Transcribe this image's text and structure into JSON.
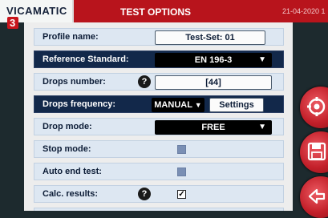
{
  "header": {
    "logo_prefix": "VICAMATIC",
    "logo_badge": "3",
    "title": "TEST OPTIONS",
    "date": "21-04-2020 1"
  },
  "form": {
    "profile_name": {
      "label": "Profile name:",
      "value": "Test-Set: 01"
    },
    "reference_standard": {
      "label": "Reference Standard:",
      "value": "EN 196-3"
    },
    "drops_number": {
      "label": "Drops number:",
      "value": "[44]",
      "help": "?"
    },
    "drops_frequency": {
      "label": "Drops frequency:",
      "value": "MANUAL",
      "settings_label": "Settings"
    },
    "drop_mode": {
      "label": "Drop mode:",
      "value": "FREE"
    },
    "stop_mode": {
      "label": "Stop mode:",
      "checked": false
    },
    "auto_end_test": {
      "label": "Auto end test:",
      "checked": false
    },
    "calc_results": {
      "label": "Calc. results:",
      "checked": true,
      "help": "?",
      "check_glyph": "✓"
    }
  },
  "side_buttons": [
    {
      "name": "test-settings",
      "icon": "gear-test-icon"
    },
    {
      "name": "save",
      "icon": "floppy-disk-icon"
    },
    {
      "name": "back",
      "icon": "back-arrow-icon"
    }
  ],
  "colors": {
    "brand_red": "#b8141c",
    "row_dark": "#12284a",
    "row_light": "#dde7f2"
  }
}
